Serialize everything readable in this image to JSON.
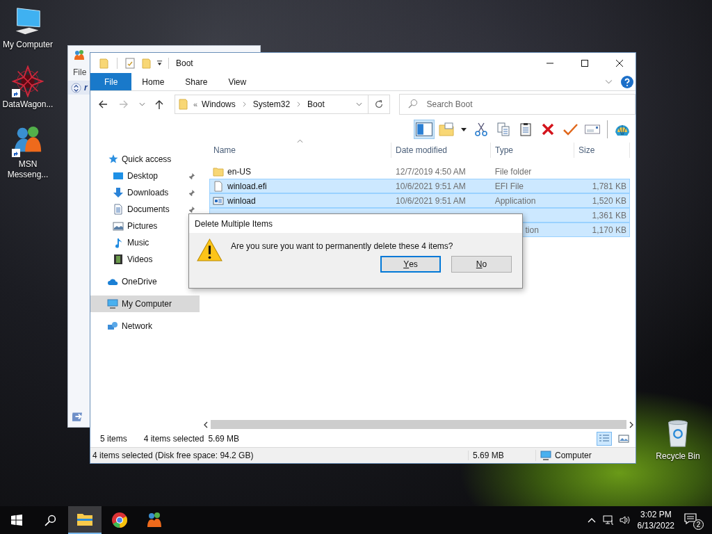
{
  "desktop_icons": [
    {
      "label": "My Computer",
      "kind": "computer",
      "shortcut": false
    },
    {
      "label": "DataWagon...",
      "kind": "web",
      "shortcut": true
    },
    {
      "label": "MSN Messeng...",
      "kind": "people",
      "shortcut": true
    }
  ],
  "recycle_bin": {
    "label": "Recycle Bin"
  },
  "back_window": {
    "menu": "File",
    "header_fragment": "r"
  },
  "explorer": {
    "title": "Boot",
    "ribbon_tabs": [
      {
        "label": "File",
        "kind": "file"
      },
      {
        "label": "Home",
        "kind": "tab"
      },
      {
        "label": "Share",
        "kind": "tab"
      },
      {
        "label": "View",
        "kind": "tab"
      }
    ],
    "address": {
      "prefix": "«",
      "path": [
        "Windows",
        "System32",
        "Boot"
      ]
    },
    "search": {
      "placeholder": "Search Boot"
    },
    "preview_pane": {
      "on": true
    },
    "navigation": [
      {
        "label": "Quick access",
        "kind": "star",
        "selected": false,
        "children": [
          {
            "label": "Desktop",
            "kind": "desktop",
            "pinned": true,
            "selected": false
          },
          {
            "label": "Downloads",
            "kind": "download",
            "pinned": true,
            "selected": false
          },
          {
            "label": "Documents",
            "kind": "document",
            "pinned": true,
            "selected": false
          },
          {
            "label": "Pictures",
            "kind": "picture",
            "pinned": false,
            "selected": false
          },
          {
            "label": "Music",
            "kind": "music",
            "pinned": false,
            "selected": false
          },
          {
            "label": "Videos",
            "kind": "video",
            "pinned": false,
            "selected": false
          }
        ]
      },
      {
        "label": "OneDrive",
        "kind": "cloud",
        "selected": false
      },
      {
        "label": "My Computer",
        "kind": "computer",
        "selected": true
      },
      {
        "label": "Network",
        "kind": "network",
        "selected": false
      }
    ],
    "columns": [
      {
        "label": "Name",
        "sorted": true
      },
      {
        "label": "Date modified",
        "sorted": false
      },
      {
        "label": "Type",
        "sorted": false
      },
      {
        "label": "Size",
        "sorted": false
      }
    ],
    "files": [
      {
        "kind": "folder",
        "name": "en-US",
        "date": "12/7/2019 4:50 AM",
        "type": "File folder",
        "selected": false
      },
      {
        "kind": "file",
        "name": "winload.efi",
        "date": "10/6/2021 9:51 AM",
        "type": "EFI File",
        "size": "1,781 KB",
        "selected": true
      },
      {
        "kind": "app",
        "name": "winload",
        "date": "10/6/2021 9:51 AM",
        "type": "Application",
        "size": "1,520 KB",
        "selected": true
      },
      {
        "kind": "covered",
        "size": "1,361 KB",
        "selected": true
      },
      {
        "kind": "covered",
        "type": "tion",
        "size": "1,170 KB",
        "selected": true
      }
    ],
    "summary": {
      "count": "5 items",
      "selection": "4 items selected",
      "size": "5.69 MB"
    },
    "view_buttons": [
      {
        "kind": "details",
        "selected": true
      },
      {
        "kind": "thumbnails",
        "selected": false
      }
    ],
    "status_bar": {
      "selection": "4 items selected (Disk free space: 94.2 GB)",
      "size": "5.69 MB",
      "location": "Computer"
    }
  },
  "dialog": {
    "title": "Delete Multiple Items",
    "message": "Are you sure you want to permanently delete these 4 items?",
    "buttons": [
      {
        "label": "Yes",
        "focused": true
      },
      {
        "label": "No",
        "focused": false
      }
    ]
  },
  "taskbar": {
    "apps": [
      {
        "kind": "explorer",
        "active": true
      },
      {
        "kind": "chrome",
        "active": false
      },
      {
        "kind": "people",
        "active": false
      }
    ],
    "time": "3:02 PM",
    "date": "6/13/2022",
    "notifications": "2"
  }
}
